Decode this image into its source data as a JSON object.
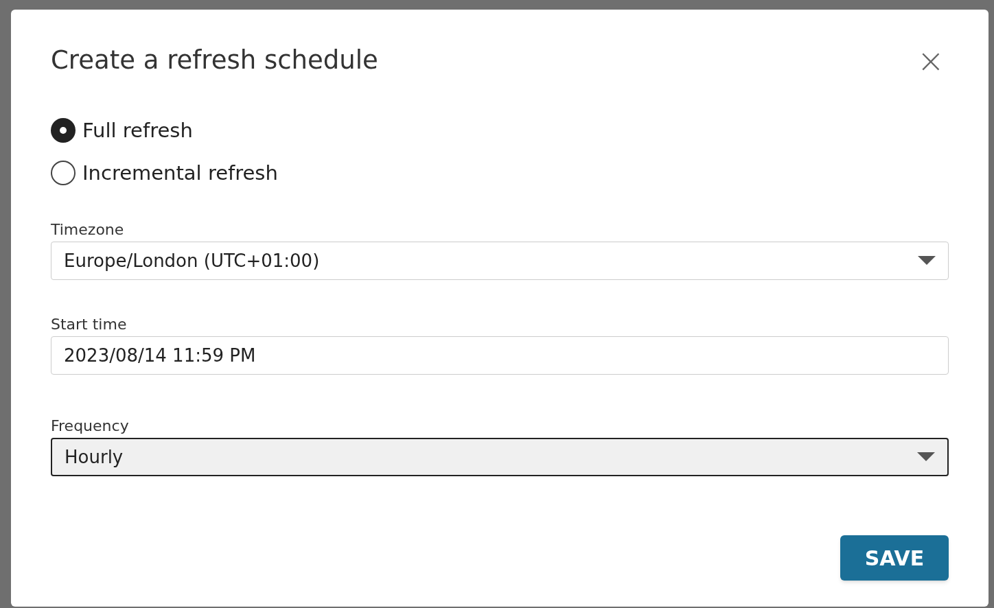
{
  "dialog": {
    "title": "Create a refresh schedule",
    "close": "×"
  },
  "refresh_type": [
    {
      "label": "Full refresh",
      "selected": true
    },
    {
      "label": "Incremental refresh",
      "selected": false
    }
  ],
  "fields": [
    {
      "kind": "select",
      "label": "Timezone",
      "value": "Europe/London (UTC+01:00)",
      "focused": false
    },
    {
      "kind": "input",
      "label": "Start time",
      "value": "2023/08/14 11:59 PM",
      "focused": false
    },
    {
      "kind": "select",
      "label": "Frequency",
      "value": "Hourly",
      "focused": true
    }
  ],
  "buttons": [
    "SAVE"
  ]
}
